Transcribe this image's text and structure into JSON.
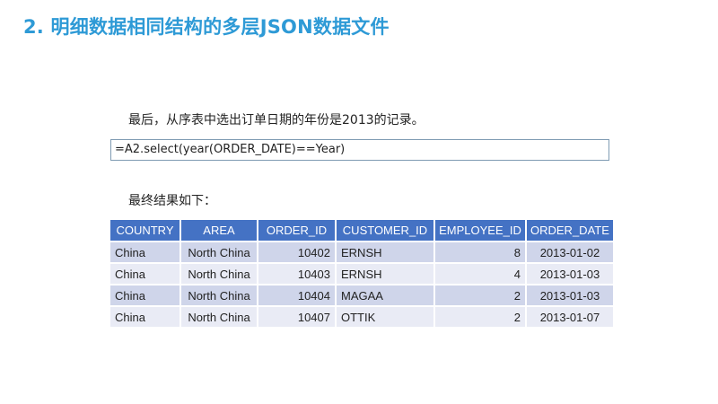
{
  "slide": {
    "title": "2. 明细数据相同结构的多层JSON数据文件",
    "intro": "最后，从序表中选出订单日期的年份是2013的记录。",
    "code": "=A2.select(year(ORDER_DATE)==Year)",
    "result_label": "最终结果如下："
  },
  "table": {
    "headers": [
      "COUNTRY",
      "AREA",
      "ORDER_ID",
      "CUSTOMER_ID",
      "EMPLOYEE_ID",
      "ORDER_DATE"
    ],
    "rows": [
      [
        "China",
        "North China",
        "10402",
        "ERNSH",
        "8",
        "2013-01-02"
      ],
      [
        "China",
        "North China",
        "10403",
        "ERNSH",
        "4",
        "2013-01-03"
      ],
      [
        "China",
        "North China",
        "10404",
        "MAGAA",
        "2",
        "2013-01-03"
      ],
      [
        "China",
        "North China",
        "10407",
        "OTTIK",
        "2",
        "2013-01-07"
      ]
    ]
  },
  "colors": {
    "title": "#2e9ad6",
    "header_bg": "#4472c4",
    "row_odd": "#cfd5ea",
    "row_even": "#e9ebf5"
  }
}
